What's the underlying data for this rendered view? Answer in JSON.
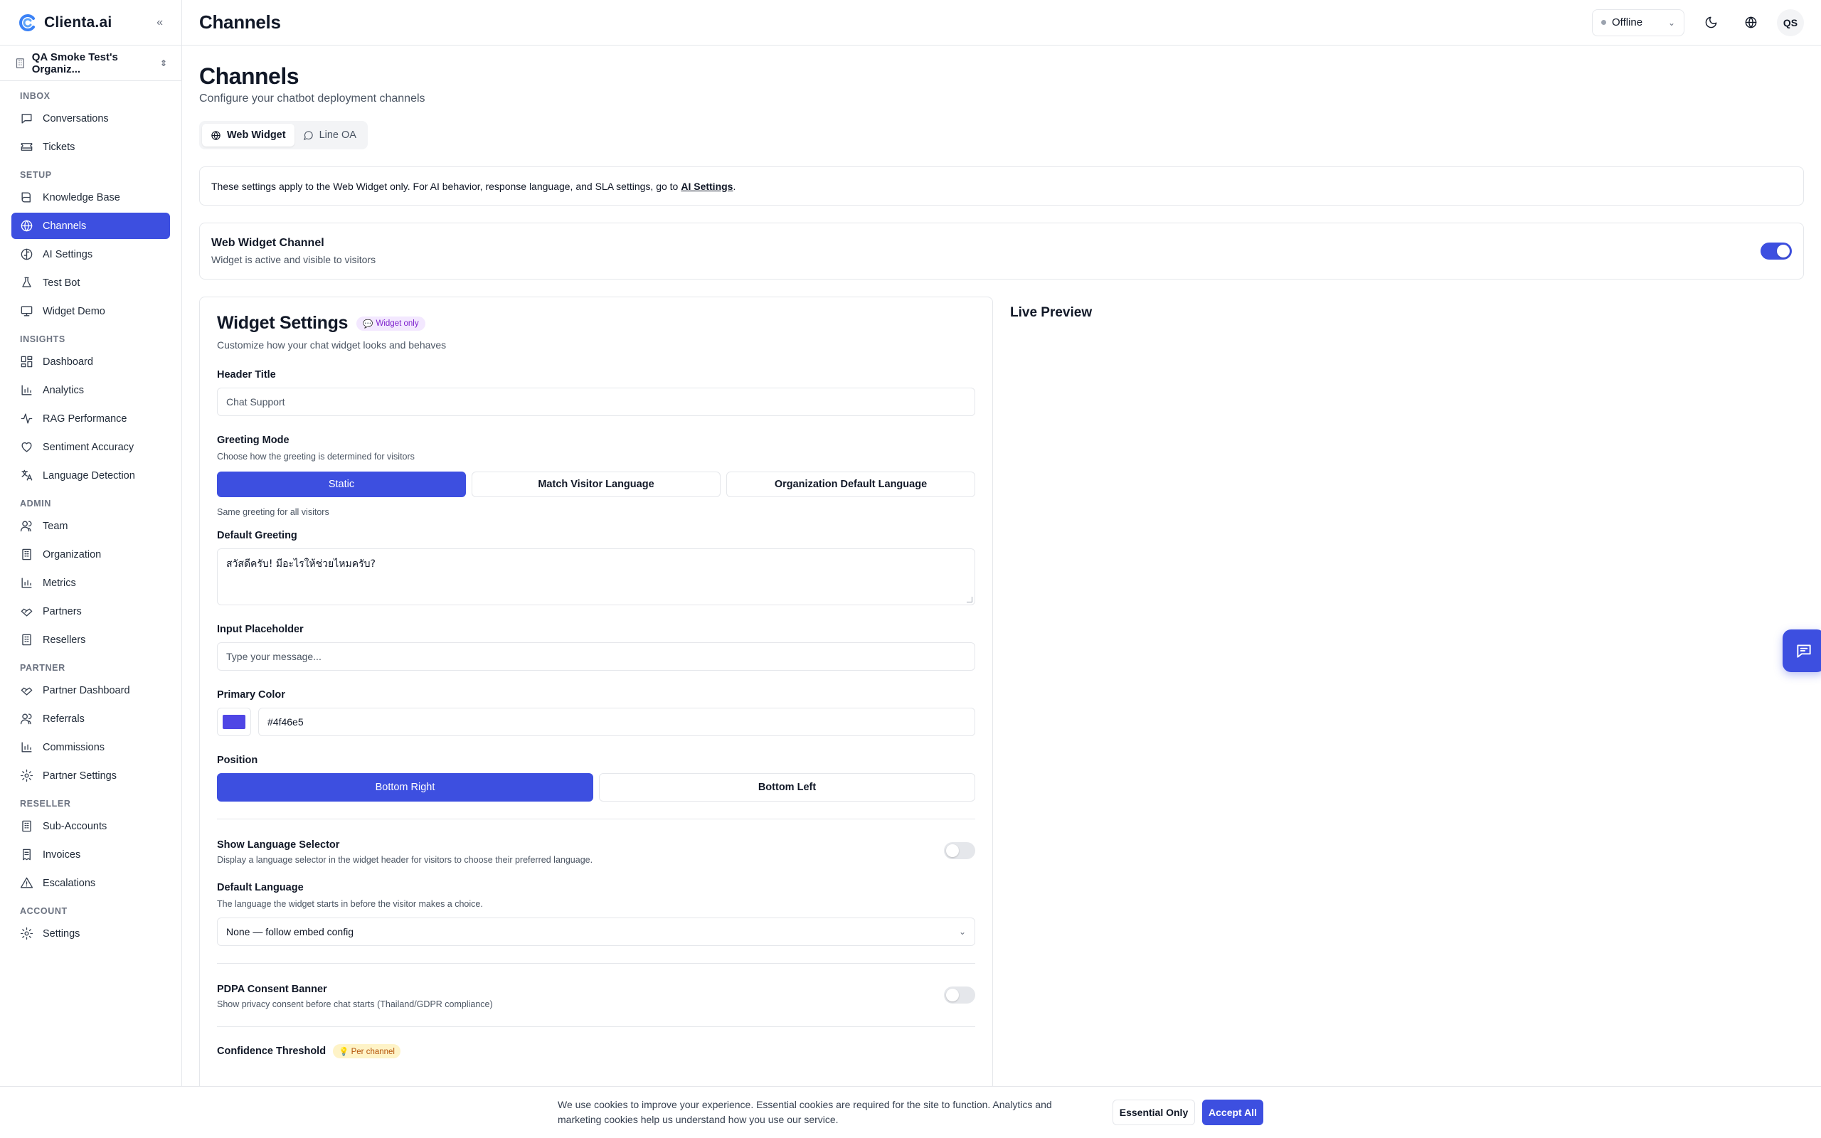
{
  "brand": {
    "name": "Clienta.ai"
  },
  "org": {
    "name": "QA Smoke Test's Organiz..."
  },
  "sidebar": {
    "sections": [
      {
        "title": "INBOX",
        "items": [
          {
            "label": "Conversations",
            "icon": "message-square-icon"
          },
          {
            "label": "Tickets",
            "icon": "ticket-icon"
          }
        ]
      },
      {
        "title": "SETUP",
        "items": [
          {
            "label": "Knowledge Base",
            "icon": "book-icon"
          },
          {
            "label": "Channels",
            "icon": "globe-icon",
            "active": true
          },
          {
            "label": "AI Settings",
            "icon": "brain-icon"
          },
          {
            "label": "Test Bot",
            "icon": "flask-icon"
          },
          {
            "label": "Widget Demo",
            "icon": "monitor-icon"
          }
        ]
      },
      {
        "title": "INSIGHTS",
        "items": [
          {
            "label": "Dashboard",
            "icon": "layout-dashboard-icon"
          },
          {
            "label": "Analytics",
            "icon": "bar-chart-icon"
          },
          {
            "label": "RAG Performance",
            "icon": "activity-icon"
          },
          {
            "label": "Sentiment Accuracy",
            "icon": "heart-icon"
          },
          {
            "label": "Language Detection",
            "icon": "languages-icon"
          }
        ]
      },
      {
        "title": "ADMIN",
        "items": [
          {
            "label": "Team",
            "icon": "users-icon"
          },
          {
            "label": "Organization",
            "icon": "building-icon"
          },
          {
            "label": "Metrics",
            "icon": "bar-chart-icon"
          },
          {
            "label": "Partners",
            "icon": "handshake-icon"
          },
          {
            "label": "Resellers",
            "icon": "building-icon"
          }
        ]
      },
      {
        "title": "PARTNER",
        "items": [
          {
            "label": "Partner Dashboard",
            "icon": "handshake-icon"
          },
          {
            "label": "Referrals",
            "icon": "users-icon"
          },
          {
            "label": "Commissions",
            "icon": "bar-chart-icon"
          },
          {
            "label": "Partner Settings",
            "icon": "gear-icon"
          }
        ]
      },
      {
        "title": "RESELLER",
        "items": [
          {
            "label": "Sub-Accounts",
            "icon": "building-icon"
          },
          {
            "label": "Invoices",
            "icon": "receipt-icon"
          },
          {
            "label": "Escalations",
            "icon": "alert-triangle-icon"
          }
        ]
      },
      {
        "title": "ACCOUNT",
        "items": [
          {
            "label": "Settings",
            "icon": "gear-icon"
          }
        ]
      }
    ]
  },
  "topbar": {
    "title": "Channels",
    "status": "Offline",
    "avatar_initials": "QS"
  },
  "page": {
    "title": "Channels",
    "subtitle": "Configure your chatbot deployment channels"
  },
  "tabs": [
    {
      "label": "Web Widget",
      "icon": "globe-icon",
      "active": true
    },
    {
      "label": "Line OA",
      "icon": "message-circle-icon",
      "active": false
    }
  ],
  "info": {
    "text": "These settings apply to the Web Widget only. For AI behavior, response language, and SLA settings, go to",
    "link": "AI Settings",
    "suffix": "."
  },
  "channel": {
    "title": "Web Widget Channel",
    "subtitle": "Widget is active and visible to visitors",
    "enabled": true
  },
  "widget_settings": {
    "title": "Widget Settings",
    "badge": "Widget only",
    "subtitle": "Customize how your chat widget looks and behaves",
    "header_title": {
      "label": "Header Title",
      "placeholder": "Chat Support"
    },
    "greeting_mode": {
      "label": "Greeting Mode",
      "hint": "Choose how the greeting is determined for visitors",
      "options": [
        "Static",
        "Match Visitor Language",
        "Organization Default Language"
      ],
      "selected": "Static",
      "note": "Same greeting for all visitors"
    },
    "default_greeting": {
      "label": "Default Greeting",
      "value": "สวัสดีครับ! มีอะไรให้ช่วยไหมครับ?"
    },
    "input_placeholder": {
      "label": "Input Placeholder",
      "placeholder": "Type your message..."
    },
    "primary_color": {
      "label": "Primary Color",
      "value": "#4f46e5",
      "swatch": "#4f46e5"
    },
    "position": {
      "label": "Position",
      "options": [
        "Bottom Right",
        "Bottom Left"
      ],
      "selected": "Bottom Right"
    },
    "language_selector": {
      "label": "Show Language Selector",
      "hint": "Display a language selector in the widget header for visitors to choose their preferred language.",
      "enabled": false
    },
    "default_language": {
      "label": "Default Language",
      "hint": "The language the widget starts in before the visitor makes a choice.",
      "value": "None — follow embed config"
    },
    "pdpa": {
      "label": "PDPA Consent Banner",
      "hint": "Show privacy consent before chat starts (Thailand/GDPR compliance)",
      "enabled": false
    },
    "confidence": {
      "label": "Confidence Threshold",
      "badge": "Per channel"
    }
  },
  "preview": {
    "title": "Live Preview"
  },
  "cookie": {
    "text": "We use cookies to improve your experience. Essential cookies are required for the site to function. Analytics and marketing cookies help us understand how you use our service.",
    "essential": "Essential Only",
    "accept": "Accept All"
  },
  "colors": {
    "accent": "#3d4fe0",
    "brand_swatch": "#4f46e5"
  }
}
